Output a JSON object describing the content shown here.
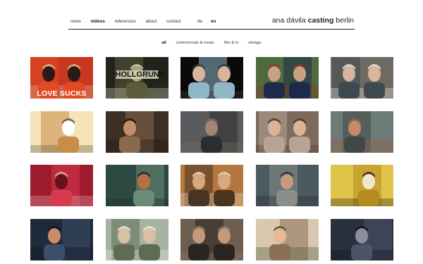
{
  "nav": {
    "items": [
      {
        "label": "news",
        "active": false
      },
      {
        "label": "videos",
        "active": true
      },
      {
        "label": "references",
        "active": false
      },
      {
        "label": "about",
        "active": false
      },
      {
        "label": "contact",
        "active": false
      }
    ],
    "separator": "."
  },
  "lang": {
    "items": [
      {
        "label": "de",
        "active": false
      },
      {
        "label": "en",
        "active": true
      }
    ],
    "separator": "."
  },
  "brand": {
    "part1": "ana dávila ",
    "bold": "casting",
    "part2": " berlin"
  },
  "filters": {
    "items": [
      {
        "label": "all",
        "active": true
      },
      {
        "label": "commercials & music",
        "active": false
      },
      {
        "label": "film & tv",
        "active": false
      },
      {
        "label": "vintage",
        "active": false
      }
    ],
    "separator": "."
  },
  "thumbnails": [
    {
      "caption": "LOVE SUCKS",
      "palette": [
        "#c8371f",
        "#e14b24",
        "#2a1a18",
        "#d9b38f"
      ]
    },
    {
      "caption": "HOLLGRUND",
      "palette": [
        "#20251b",
        "#5d5a3c",
        "#a9a57e",
        "#d4ceb0"
      ]
    },
    {
      "caption": "",
      "palette": [
        "#0a0a0a",
        "#8fb7c8",
        "#d9b49a",
        "#3b3b3b"
      ]
    },
    {
      "caption": "",
      "palette": [
        "#4f6a3c",
        "#1e2a4a",
        "#c9a081",
        "#8b3a2f"
      ]
    },
    {
      "caption": "",
      "palette": [
        "#6e6a63",
        "#3e4a4f",
        "#d8b59c",
        "#e7e2da"
      ]
    },
    {
      "caption": "",
      "palette": [
        "#f4e4b8",
        "#c98d4a",
        "#ffffff",
        "#6b5a45"
      ]
    },
    {
      "caption": "",
      "palette": [
        "#3e2f24",
        "#8a6a4f",
        "#c28e6a",
        "#1c1a18"
      ]
    },
    {
      "caption": "",
      "palette": [
        "#5a5b5e",
        "#2c2d30",
        "#a48571",
        "#7a6a5c"
      ]
    },
    {
      "caption": "",
      "palette": [
        "#7c6b5c",
        "#b8a394",
        "#d7b49a",
        "#4a3d34"
      ]
    },
    {
      "caption": "",
      "palette": [
        "#6c7a78",
        "#3f4847",
        "#c48b6a",
        "#9a5e40"
      ]
    },
    {
      "caption": "",
      "palette": [
        "#9e1b2e",
        "#d63a4c",
        "#6a0f1c",
        "#e6a4a8"
      ]
    },
    {
      "caption": "",
      "palette": [
        "#2d4a42",
        "#6c8b7a",
        "#b96e3f",
        "#1d2c28"
      ]
    },
    {
      "caption": "",
      "palette": [
        "#b3773f",
        "#4b3322",
        "#d9a87c",
        "#e8d5b9"
      ]
    },
    {
      "caption": "",
      "palette": [
        "#4a5a60",
        "#8a8f8a",
        "#c79a80",
        "#2a2f33"
      ]
    },
    {
      "caption": "",
      "palette": [
        "#e0c44a",
        "#b58a1e",
        "#efe7d0",
        "#3a2a18"
      ]
    },
    {
      "caption": "",
      "palette": [
        "#1f2a3a",
        "#3b4f6a",
        "#c98d6a",
        "#0f1520"
      ]
    },
    {
      "caption": "",
      "palette": [
        "#a7b3a0",
        "#5f6b55",
        "#d8c0a4",
        "#ece8de"
      ]
    },
    {
      "caption": "",
      "palette": [
        "#6d5e50",
        "#2b2420",
        "#c49a7c",
        "#8c7a68"
      ]
    },
    {
      "caption": "",
      "palette": [
        "#d8c8b0",
        "#8a6f55",
        "#e7b894",
        "#4b5a3a"
      ]
    },
    {
      "caption": "",
      "palette": [
        "#2a3040",
        "#4e5468",
        "#8a8fa0",
        "#121520"
      ]
    }
  ]
}
